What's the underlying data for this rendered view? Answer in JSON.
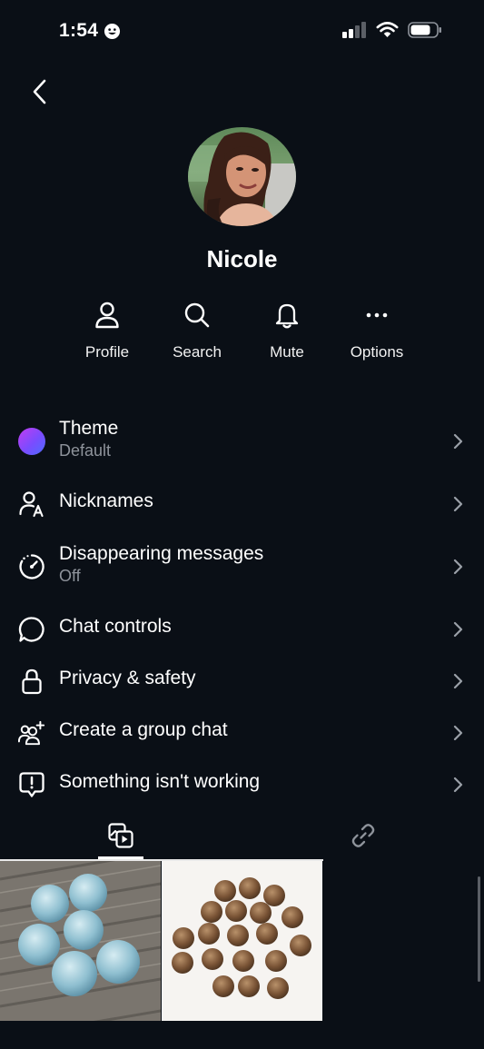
{
  "status_bar": {
    "time": "1:54",
    "time_icon": "smiley-icon",
    "signal": "signal-bars-icon",
    "wifi": "wifi-icon",
    "battery": "battery-icon"
  },
  "header": {
    "back_icon": "back-chevron-icon"
  },
  "profile": {
    "name": "Nicole"
  },
  "actions": [
    {
      "label": "Profile",
      "icon": "person-icon"
    },
    {
      "label": "Search",
      "icon": "search-icon"
    },
    {
      "label": "Mute",
      "icon": "bell-icon"
    },
    {
      "label": "Options",
      "icon": "more-icon"
    }
  ],
  "settings": [
    {
      "title": "Theme",
      "subtitle": "Default",
      "icon": "theme-gradient-icon"
    },
    {
      "title": "Nicknames",
      "icon": "nickname-icon"
    },
    {
      "title": "Disappearing messages",
      "subtitle": "Off",
      "icon": "timer-icon"
    },
    {
      "title": "Chat controls",
      "icon": "chat-bubble-icon"
    },
    {
      "title": "Privacy & safety",
      "icon": "lock-icon"
    },
    {
      "title": "Create a group chat",
      "icon": "add-group-icon"
    },
    {
      "title": "Something isn't working",
      "icon": "report-icon"
    }
  ],
  "media_tabs": [
    {
      "name": "media",
      "icon": "media-icon",
      "selected": true
    },
    {
      "name": "links",
      "icon": "link-icon",
      "selected": false
    }
  ],
  "colors": {
    "background": "#0a0f16",
    "theme_gradient_start": "#a23cf0",
    "theme_gradient_end": "#4d6cff",
    "subtitle": "#8e939b"
  }
}
